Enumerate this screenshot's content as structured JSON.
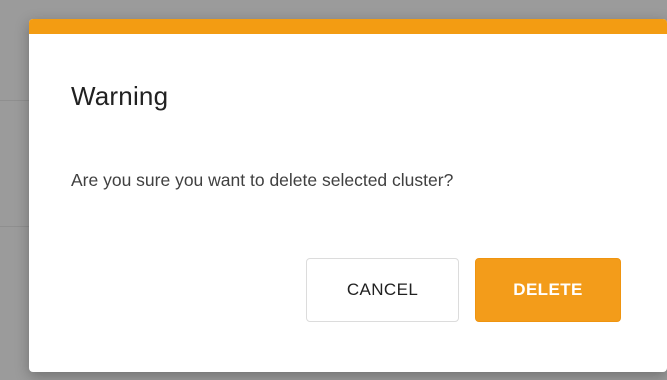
{
  "dialog": {
    "title": "Warning",
    "message": "Are you sure you want to delete selected cluster?",
    "cancel_label": "CANCEL",
    "delete_label": "DELETE"
  },
  "colors": {
    "accent": "#f39c12",
    "overlay": "#9b9b9b",
    "dialog_background": "#ffffff",
    "primary_button": "#f39c1a",
    "primary_button_text": "#ffffff"
  }
}
